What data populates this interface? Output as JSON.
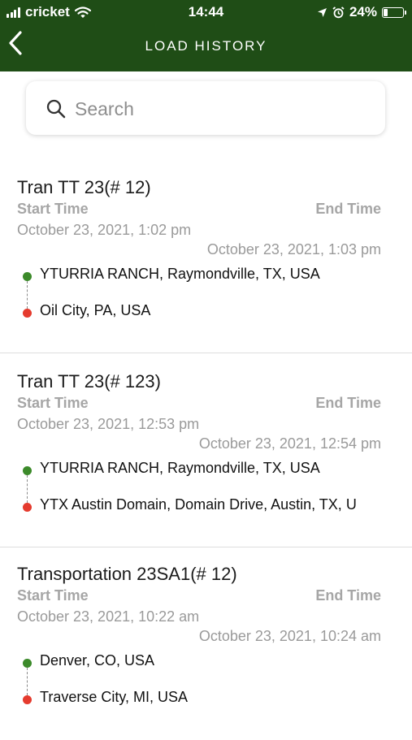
{
  "status_bar": {
    "carrier": "cricket",
    "time": "14:44",
    "battery": "24%"
  },
  "header": {
    "title": "LOAD HISTORY",
    "back_icon": "chevron-left-icon"
  },
  "search": {
    "placeholder": "Search",
    "value": ""
  },
  "loads": [
    {
      "title": "Tran TT 23(# 12)",
      "start_label": "Start Time",
      "end_label": "End Time",
      "start_time": "October 23, 2021, 1:02 pm",
      "end_time": "October 23, 2021, 1:03 pm",
      "origin": "YTURRIA RANCH, Raymondville, TX, USA",
      "destination": "Oil City, PA, USA"
    },
    {
      "title": "Tran TT 23(# 123)",
      "start_label": "Start Time",
      "end_label": "End Time",
      "start_time": "October 23, 2021, 12:53 pm",
      "end_time": "October 23, 2021, 12:54 pm",
      "origin": "YTURRIA RANCH, Raymondville, TX, USA",
      "destination": "YTX Austin Domain, Domain Drive, Austin, TX, U"
    },
    {
      "title": "Transportation 23SA1(# 12)",
      "start_label": "Start Time",
      "end_label": "End Time",
      "start_time": "October 23, 2021, 10:22 am",
      "end_time": "October 23, 2021, 10:24 am",
      "origin": "Denver, CO, USA",
      "destination": "Traverse City, MI, USA"
    }
  ],
  "colors": {
    "header_bg": "#1f4d16",
    "origin_dot": "#3c8a2a",
    "destination_dot": "#e53b2e"
  }
}
